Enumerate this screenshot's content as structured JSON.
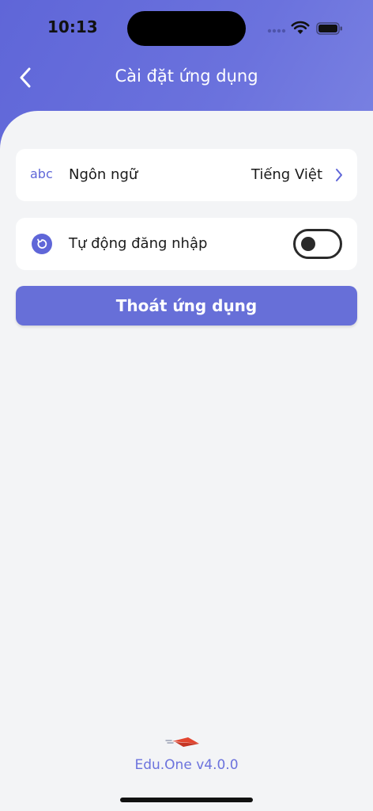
{
  "status_bar": {
    "time": "10:13"
  },
  "header": {
    "title": "Cài đặt ứng dụng"
  },
  "settings": {
    "language": {
      "icon_text": "abc",
      "label": "Ngôn ngữ",
      "value": "Tiếng Việt"
    },
    "auto_login": {
      "label": "Tự động đăng nhập",
      "enabled": false
    }
  },
  "logout_button": {
    "label": "Thoát ứng dụng"
  },
  "footer": {
    "version": "Edu.One v4.0.0"
  },
  "colors": {
    "accent": "#676fd8",
    "header_start": "#5f66d8",
    "header_end": "#7a82e2",
    "background": "#f3f4f6"
  },
  "icons": [
    "back-chevron-icon",
    "abc-icon",
    "chevron-right-icon",
    "refresh-icon",
    "paper-plane-logo-icon",
    "wifi-icon",
    "battery-icon",
    "signal-icon"
  ]
}
